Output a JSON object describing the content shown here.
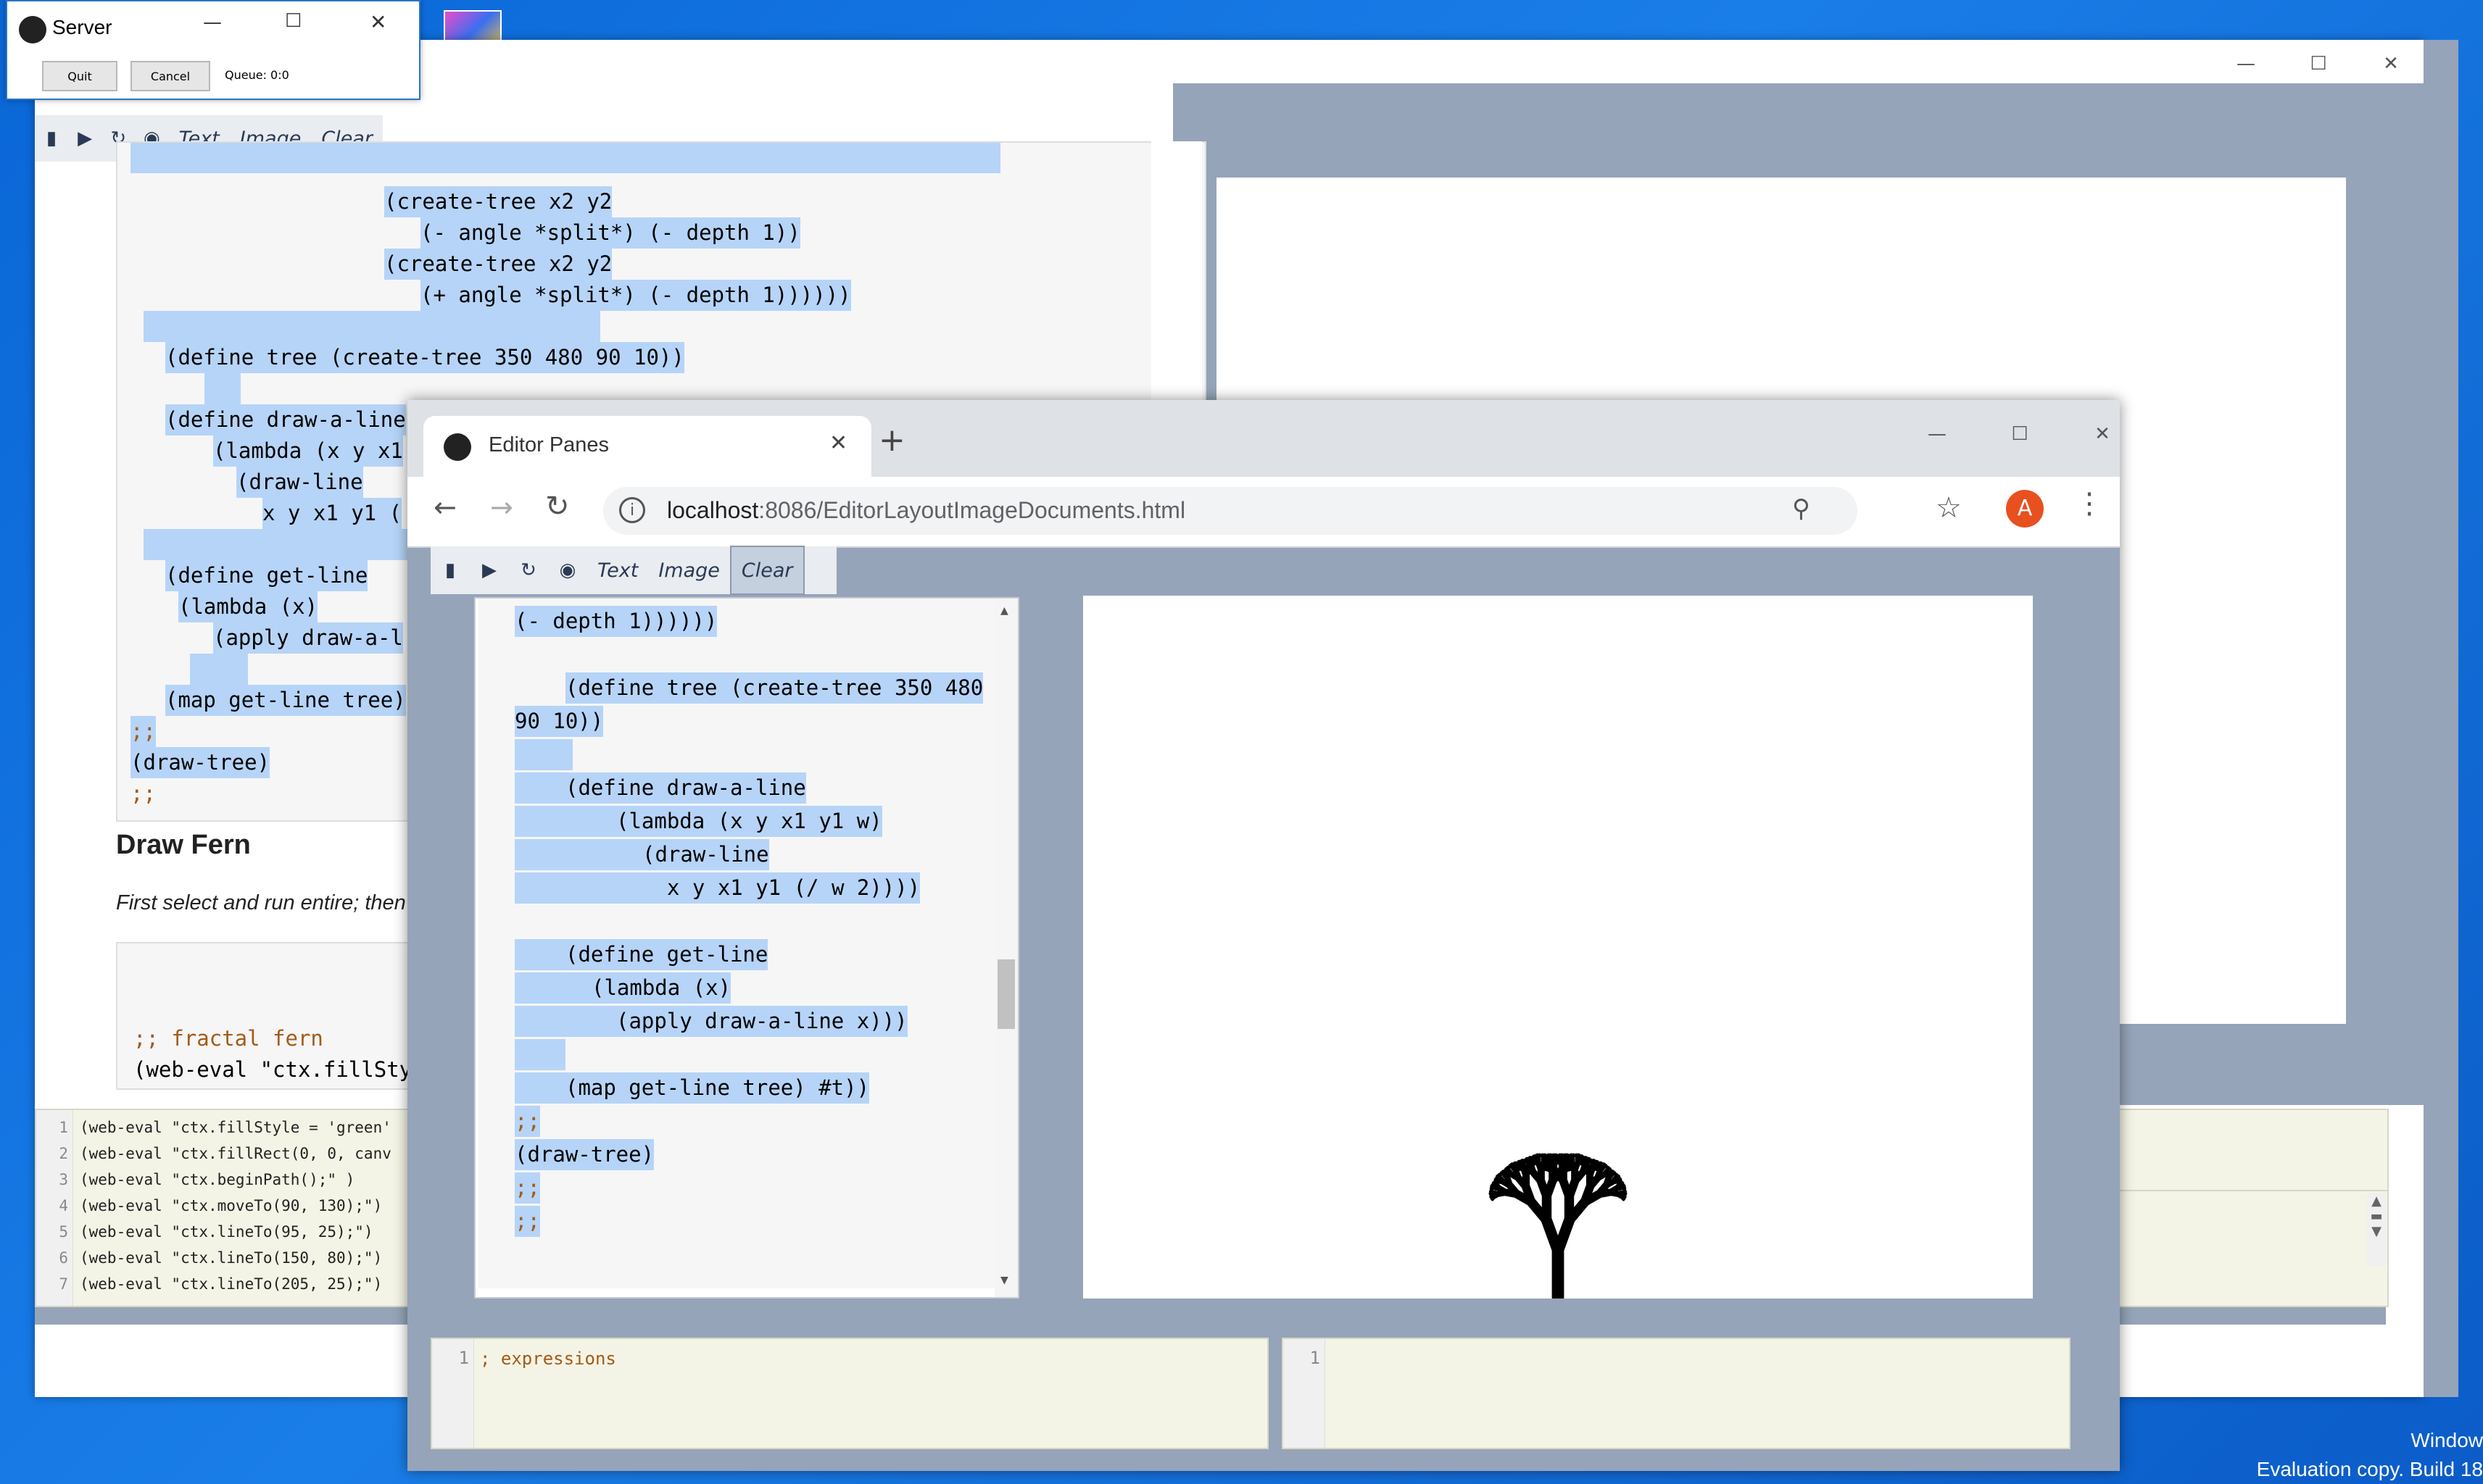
{
  "server": {
    "title": "Server",
    "quit": "Quit",
    "cancel": "Cancel",
    "queue": "Queue: 0:0"
  },
  "back": {
    "toolbar": {
      "text": "Text",
      "image": "Image",
      "clear": "Clear"
    },
    "code": [
      "(create-tree x2 y2",
      "(- angle *split*) (- depth 1))",
      "(create-tree x2 y2",
      "(+ angle *split*) (- depth 1))))))",
      "",
      "(define tree (create-tree 350 480 90 10))",
      "",
      "(define draw-a-line",
      "(lambda (x y x1",
      "(draw-line",
      "x y x1 y1 (",
      "",
      "(define get-line",
      "(lambda (x)",
      "(apply draw-a-l",
      "",
      "(map get-line tree)",
      ";;",
      "(draw-tree)",
      ";;"
    ],
    "section_title": "Draw Fern",
    "section_text": "First select and run entire; then",
    "fern_code": [
      ";; fractal fern",
      "(web-eval \"ctx.fillStyle"
    ],
    "bottom_editor": [
      {
        "n": "1",
        "code": "(web-eval \"ctx.fillStyle = 'green'"
      },
      {
        "n": "2",
        "code": "(web-eval \"ctx.fillRect(0, 0, canv"
      },
      {
        "n": "3",
        "code": "(web-eval \"ctx.beginPath();\" )"
      },
      {
        "n": "4",
        "code": "(web-eval \"ctx.moveTo(90, 130);\")"
      },
      {
        "n": "5",
        "code": "(web-eval \"ctx.lineTo(95, 25);\")"
      },
      {
        "n": "6",
        "code": "(web-eval \"ctx.lineTo(150, 80);\")"
      },
      {
        "n": "7",
        "code": "(web-eval \"ctx.lineTo(205, 25);\")"
      }
    ]
  },
  "browser": {
    "tab_title": "Editor Panes",
    "url_host": "localhost",
    "url_rest": ":8086/EditorLayoutImageDocuments.html",
    "avatar_letter": "A",
    "toolbar": {
      "text": "Text",
      "image": "Image",
      "clear": "Clear"
    },
    "code": [
      "(- depth 1))))))",
      "",
      "(define tree (create-tree 350 480",
      "90 10))",
      "",
      "(define draw-a-line",
      "(lambda (x y x1 y1 w)",
      "(draw-line",
      "x y x1 y1 (/ w 2))))",
      "",
      "(define get-line",
      "(lambda (x)",
      "(apply draw-a-line x)))",
      "",
      "(map get-line tree) #t))",
      ";;",
      "(draw-tree)",
      ";;",
      ";;"
    ],
    "expr_editor": {
      "line": "1",
      "text": "; expressions"
    },
    "result_editor": {
      "line": "1",
      "text": ""
    }
  },
  "desktop": {
    "watermark_line1": "Window",
    "watermark_line2": "Evaluation copy. Build 18"
  },
  "colors": {
    "selection": "#b6d4f7",
    "panel_gray": "#95a4b8",
    "avatar": "#e8501f"
  }
}
